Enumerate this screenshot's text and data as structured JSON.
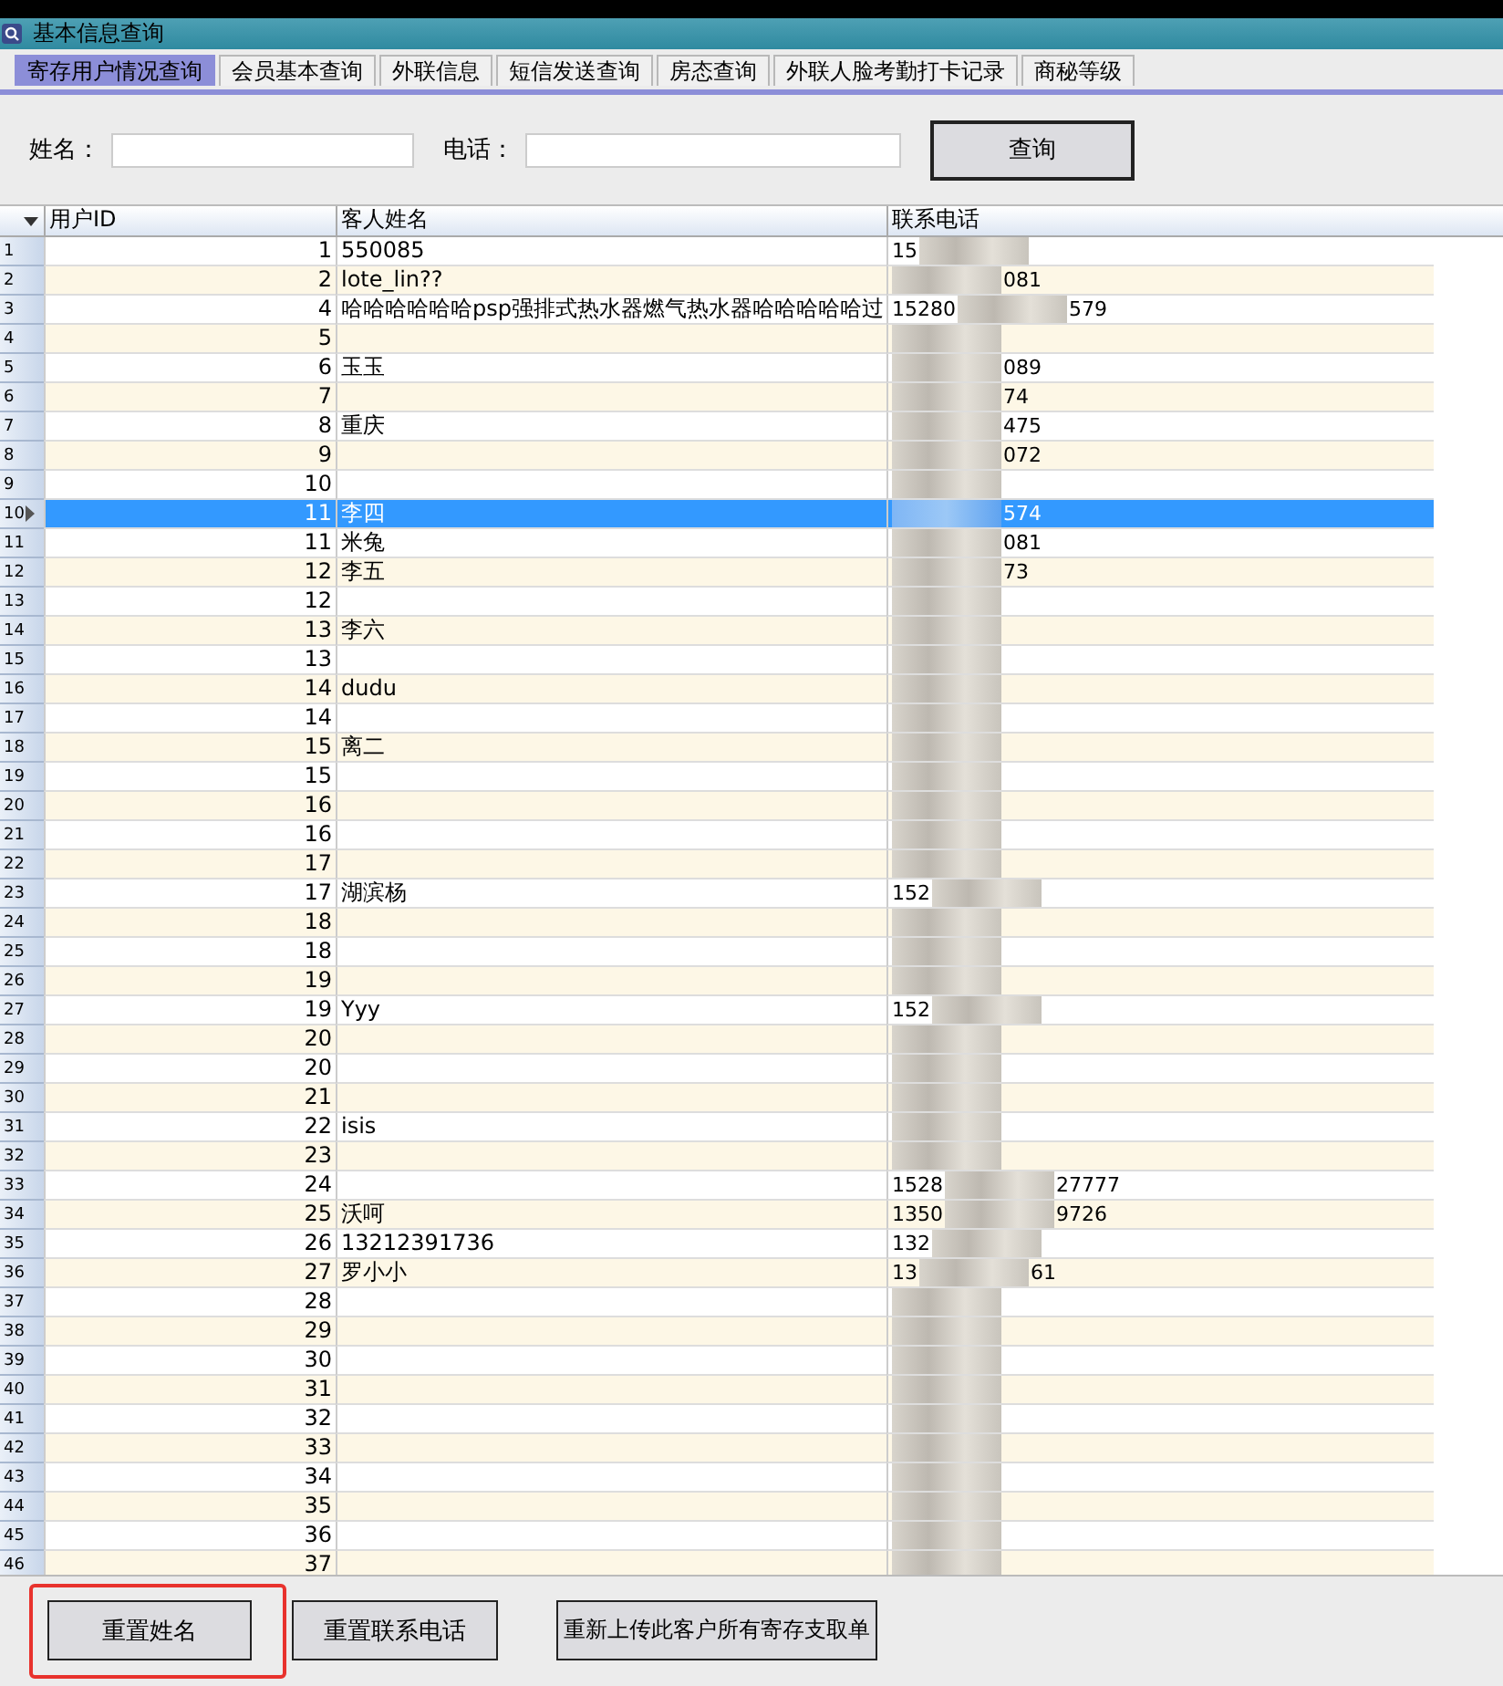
{
  "window": {
    "title": "基本信息查询"
  },
  "tabs": [
    {
      "label": "寄存用户情况查询",
      "selected": true
    },
    {
      "label": "会员基本查询",
      "selected": false
    },
    {
      "label": "外联信息",
      "selected": false
    },
    {
      "label": "短信发送查询",
      "selected": false
    },
    {
      "label": "房态查询",
      "selected": false
    },
    {
      "label": "外联人脸考勤打卡记录",
      "selected": false
    },
    {
      "label": "商秘等级",
      "selected": false
    }
  ],
  "search": {
    "name_label": "姓名：",
    "phone_label": "电话：",
    "button": "查询"
  },
  "table": {
    "columns": [
      "用户ID",
      "客人姓名",
      "联系电话"
    ],
    "rows": [
      {
        "n": "1",
        "id": "1",
        "name": "550085",
        "phone_start": "15",
        "selected": false
      },
      {
        "n": "2",
        "id": "2",
        "name": "lote_lin??",
        "phone_end": "081",
        "selected": false
      },
      {
        "n": "3",
        "id": "4",
        "name": "哈哈哈哈哈哈psp强排式热水器燃气热水器哈哈哈哈哈过",
        "phone_start": "15280",
        "phone_end": "579",
        "selected": false
      },
      {
        "n": "4",
        "id": "5",
        "selected": false
      },
      {
        "n": "5",
        "id": "6",
        "name": "玉玉",
        "phone_end": "089",
        "selected": false
      },
      {
        "n": "6",
        "id": "7",
        "phone_end": "74",
        "selected": false
      },
      {
        "n": "7",
        "id": "8",
        "name": "重庆",
        "phone_end": "475",
        "selected": false
      },
      {
        "n": "8",
        "id": "9",
        "phone_end": "072",
        "selected": false
      },
      {
        "n": "9",
        "id": "10",
        "selected": false
      },
      {
        "n": "10",
        "id": "11",
        "name": "李四",
        "phone_end": "574",
        "selected": true
      },
      {
        "n": "11",
        "id": "11",
        "name": "米兔",
        "phone_end": "081",
        "selected": false
      },
      {
        "n": "12",
        "id": "12",
        "name": "李五",
        "phone_end": "73",
        "selected": false
      },
      {
        "n": "13",
        "id": "12",
        "selected": false
      },
      {
        "n": "14",
        "id": "13",
        "name": "李六",
        "selected": false
      },
      {
        "n": "15",
        "id": "13",
        "selected": false
      },
      {
        "n": "16",
        "id": "14",
        "name": "dudu",
        "selected": false
      },
      {
        "n": "17",
        "id": "14",
        "selected": false
      },
      {
        "n": "18",
        "id": "15",
        "name": "离二",
        "selected": false
      },
      {
        "n": "19",
        "id": "15",
        "selected": false
      },
      {
        "n": "20",
        "id": "16",
        "selected": false
      },
      {
        "n": "21",
        "id": "16",
        "selected": false
      },
      {
        "n": "22",
        "id": "17",
        "selected": false
      },
      {
        "n": "23",
        "id": "17",
        "name": "湖滨杨",
        "phone_start": "152",
        "selected": false
      },
      {
        "n": "24",
        "id": "18",
        "selected": false
      },
      {
        "n": "25",
        "id": "18",
        "selected": false
      },
      {
        "n": "26",
        "id": "19",
        "selected": false
      },
      {
        "n": "27",
        "id": "19",
        "name": "Yyy",
        "phone_start": "152",
        "selected": false
      },
      {
        "n": "28",
        "id": "20",
        "selected": false
      },
      {
        "n": "29",
        "id": "20",
        "selected": false
      },
      {
        "n": "30",
        "id": "21",
        "selected": false
      },
      {
        "n": "31",
        "id": "22",
        "name": "isis",
        "selected": false
      },
      {
        "n": "32",
        "id": "23",
        "selected": false
      },
      {
        "n": "33",
        "id": "24",
        "phone_start": "1528",
        "phone_end": "27777",
        "selected": false
      },
      {
        "n": "34",
        "id": "25",
        "name": "沃呵",
        "phone_start": "1350",
        "phone_end": "9726",
        "selected": false
      },
      {
        "n": "35",
        "id": "26",
        "name": "13212391736",
        "phone_start": "132",
        "selected": false
      },
      {
        "n": "36",
        "id": "27",
        "name": "罗小小",
        "phone_start": "13",
        "phone_end": "61",
        "selected": false
      },
      {
        "n": "37",
        "id": "28",
        "selected": false
      },
      {
        "n": "38",
        "id": "29",
        "selected": false
      },
      {
        "n": "39",
        "id": "30",
        "selected": false
      },
      {
        "n": "40",
        "id": "31",
        "selected": false
      },
      {
        "n": "41",
        "id": "32",
        "selected": false
      },
      {
        "n": "42",
        "id": "33",
        "selected": false
      },
      {
        "n": "43",
        "id": "34",
        "selected": false
      },
      {
        "n": "44",
        "id": "35",
        "selected": false
      },
      {
        "n": "45",
        "id": "36",
        "selected": false
      },
      {
        "n": "46",
        "id": "37",
        "selected": false
      }
    ]
  },
  "buttons": [
    {
      "label": "重置姓名",
      "highlighted": true
    },
    {
      "label": "重置联系电话",
      "highlighted": false
    },
    {
      "label": "重新上传此客户所有寄存支取单",
      "highlighted": false
    }
  ]
}
